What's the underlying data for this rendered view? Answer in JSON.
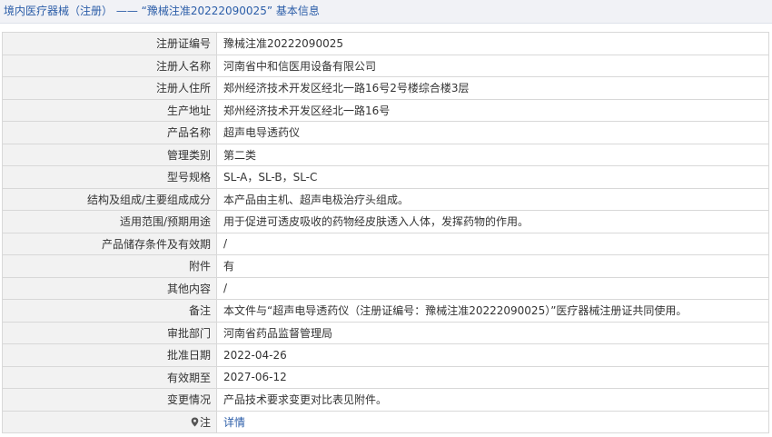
{
  "page": {
    "title": "境内医疗器械（注册） —— “豫械注准20222090025” 基本信息"
  },
  "rows": [
    {
      "label": "注册证编号",
      "value": "豫械注准20222090025"
    },
    {
      "label": "注册人名称",
      "value": "河南省中和信医用设备有限公司"
    },
    {
      "label": "注册人住所",
      "value": "郑州经济技术开发区经北一路16号2号楼综合楼3层"
    },
    {
      "label": "生产地址",
      "value": "郑州经济技术开发区经北一路16号"
    },
    {
      "label": "产品名称",
      "value": "超声电导透药仪"
    },
    {
      "label": "管理类别",
      "value": "第二类"
    },
    {
      "label": "型号规格",
      "value": "SL-A，SL-B，SL-C"
    },
    {
      "label": "结构及组成/主要组成成分",
      "value": "本产品由主机、超声电极治疗头组成。"
    },
    {
      "label": "适用范围/预期用途",
      "value": "用于促进可透皮吸收的药物经皮肤透入人体，发挥药物的作用。"
    },
    {
      "label": "产品储存条件及有效期",
      "value": "/"
    },
    {
      "label": "附件",
      "value": "有"
    },
    {
      "label": "其他内容",
      "value": "/"
    },
    {
      "label": "备注",
      "value": "本文件与“超声电导透药仪（注册证编号：豫械注准20222090025）”医疗器械注册证共同使用。"
    },
    {
      "label": "审批部门",
      "value": "河南省药品监督管理局"
    },
    {
      "label": "批准日期",
      "value": "2022-04-26"
    },
    {
      "label": "有效期至",
      "value": "2027-06-12"
    },
    {
      "label": "变更情况",
      "value": "产品技术要求变更对比表见附件。"
    }
  ],
  "note_row": {
    "label": "注",
    "icon": "map-pin-icon",
    "link_text": "详情"
  },
  "colors": {
    "title_text": "#2b5da8",
    "label_bg": "#f2f2f2",
    "border": "#d8d8d8",
    "link": "#2b5da8"
  }
}
